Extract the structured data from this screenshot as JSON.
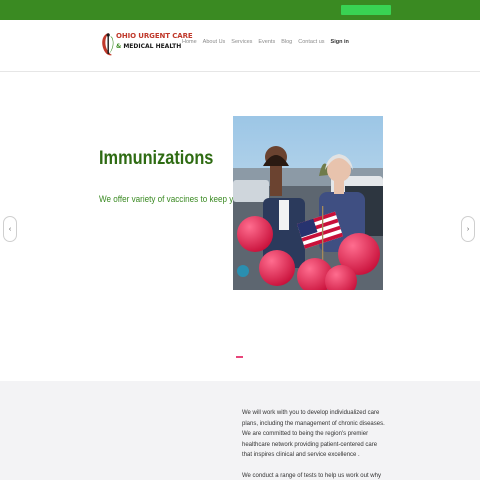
{
  "brand": {
    "line1": "OHIO URGENT CARE",
    "line2_amp": "&",
    "line2_rest": " MEDICAL HEALTH",
    "logo_icon": "caduceus-swoosh-icon",
    "red": "#c0392b",
    "green": "#3a8a22"
  },
  "nav": {
    "items": [
      "Home",
      "About Us",
      "Services",
      "Events",
      "Blog",
      "Contact us"
    ],
    "signin": "Sign in"
  },
  "hero": {
    "title": "Immunizations",
    "subtitle": "We offer variety of vaccines to keep you healthy.",
    "prev_icon": "chevron-left-icon",
    "next_icon": "chevron-right-icon",
    "prev_glyph": "‹",
    "next_glyph": "›",
    "slide_indicator_color": "#e8457a"
  },
  "about": {
    "paragraph1": "We will work with you to develop individualized care plans, including the management of chronic diseases. We are committed to being the region's premier healthcare network providing patient-centered care that inspires clinical and service excellence .",
    "paragraph2": "We conduct a range of tests to help us work out why you're not"
  }
}
